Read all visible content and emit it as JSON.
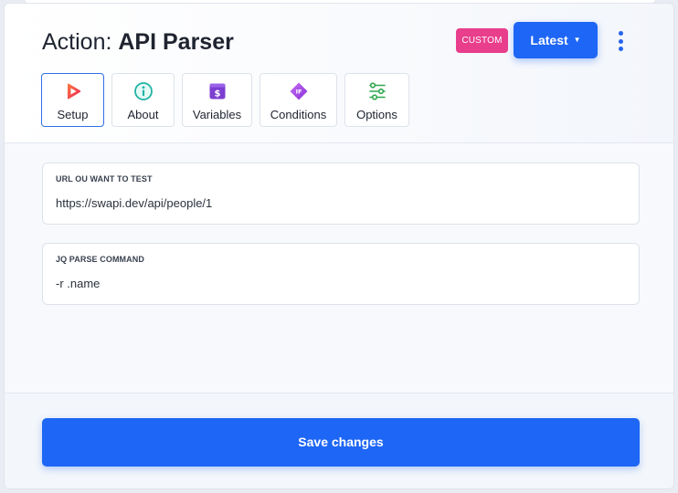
{
  "header": {
    "title_prefix": "Action: ",
    "title_name": "API Parser",
    "badge": "CUSTOM",
    "version_button": "Latest",
    "version_caret": "▼"
  },
  "tabs": [
    {
      "label": "Setup",
      "icon": "play-icon",
      "active": true
    },
    {
      "label": "About",
      "icon": "info-icon",
      "active": false
    },
    {
      "label": "Variables",
      "icon": "dollar-icon",
      "active": false
    },
    {
      "label": "Conditions",
      "icon": "if-diamond-icon",
      "active": false
    },
    {
      "label": "Options",
      "icon": "sliders-icon",
      "active": false
    }
  ],
  "fields": {
    "url": {
      "label": "URL OU WANT TO TEST",
      "value": "https://swapi.dev/api/people/1"
    },
    "jq": {
      "label": "JQ PARSE COMMAND",
      "value": "-r .name"
    }
  },
  "footer": {
    "save_label": "Save changes"
  },
  "colors": {
    "primary": "#1e66f5",
    "badge": "#e83e8c",
    "play": "#f04a3c",
    "info": "#22b3a6",
    "variables": "#7c3fd1",
    "conditions": "#a24be6",
    "options": "#2fa84f"
  }
}
